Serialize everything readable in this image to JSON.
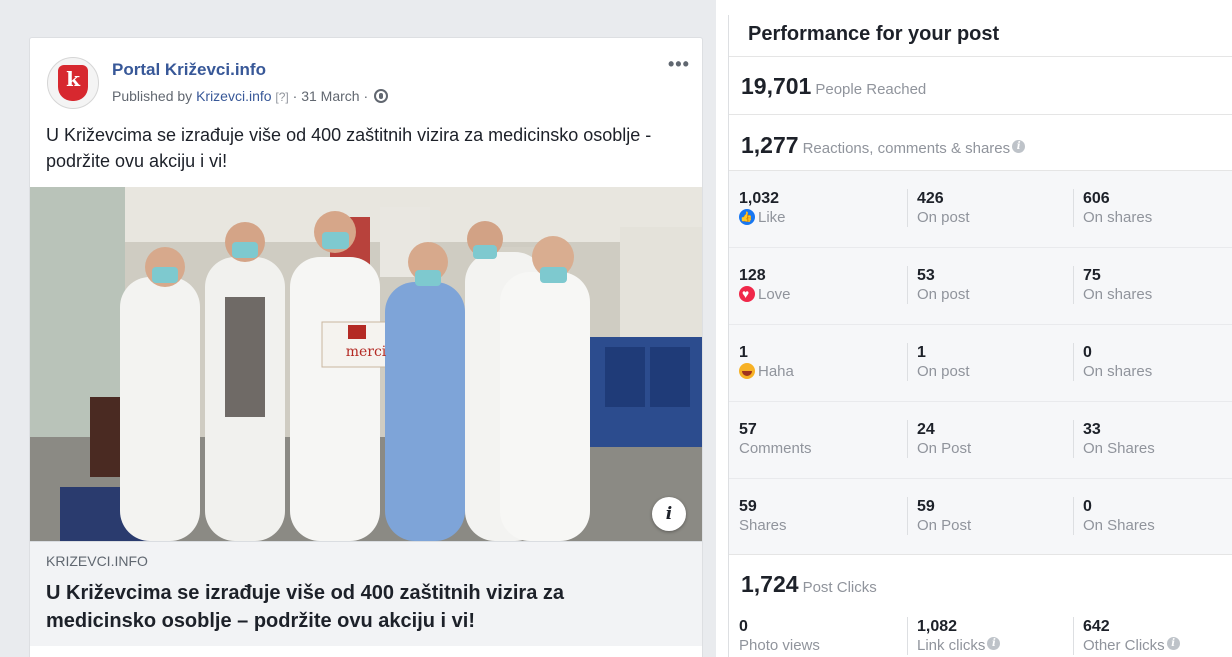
{
  "post": {
    "page_name": "Portal Križevci.info",
    "published_by_prefix": "Published by",
    "published_by_link": "Krizevci.info",
    "published_by_q": "[?]",
    "date": " · 31 March · ",
    "more_label": "•••",
    "text": "U Križevcima se izrađuje više od 400 zaštitnih vizira za medicinsko osoblje - podržite ovu akciju i vi!",
    "image_sign": "merci",
    "link_domain": "KRIZEVCI.INFO",
    "link_title": "U Križevcima se izrađuje više od 400 zaštitnih vizira za medicinsko osoblje – podržite ovu akciju i vi!",
    "avatar_letter": "k",
    "info_glyph": "i"
  },
  "performance": {
    "title": "Performance for your post",
    "reached_num": "19,701",
    "reached_label": "People Reached",
    "engagement_num": "1,277",
    "engagement_label": "Reactions, comments & shares",
    "rows": [
      {
        "num": "1,032",
        "label": "Like",
        "c2_num": "426",
        "c2_label": "On post",
        "c3_num": "606",
        "c3_label": "On shares"
      },
      {
        "num": "128",
        "label": "Love",
        "c2_num": "53",
        "c2_label": "On post",
        "c3_num": "75",
        "c3_label": "On shares"
      },
      {
        "num": "1",
        "label": "Haha",
        "c2_num": "1",
        "c2_label": "On post",
        "c3_num": "0",
        "c3_label": "On shares"
      },
      {
        "num": "57",
        "label": "Comments",
        "c2_num": "24",
        "c2_label": "On Post",
        "c3_num": "33",
        "c3_label": "On Shares"
      },
      {
        "num": "59",
        "label": "Shares",
        "c2_num": "59",
        "c2_label": "On Post",
        "c3_num": "0",
        "c3_label": "On Shares"
      }
    ],
    "clicks_num": "1,724",
    "clicks_label": "Post Clicks",
    "photo_views_num": "0",
    "photo_views_label": "Photo views",
    "link_clicks_num": "1,082",
    "link_clicks_label": "Link clicks",
    "other_clicks_num": "642",
    "other_clicks_label": "Other Clicks",
    "info_glyph": "i"
  },
  "colors": {
    "link_blue": "#385898",
    "like_blue": "#1877f2",
    "love_red": "#f0284a",
    "haha_yellow": "#f7b125"
  }
}
